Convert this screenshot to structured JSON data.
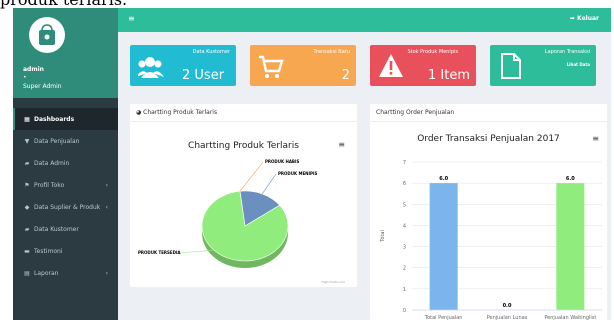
{
  "caption": "produk terlaris.",
  "topbar": {
    "menu_icon": "≡",
    "logout_label": "➦ Keluar"
  },
  "user": {
    "name": "admin",
    "status_dot": "•",
    "role": "Super Admin"
  },
  "sidebar": {
    "items": [
      {
        "label": "Dashboards",
        "icon": "dashboard-icon",
        "glyph": "▦",
        "active": true,
        "chevron": ""
      },
      {
        "label": "Data Penjualan",
        "icon": "cart-icon",
        "glyph": "▼",
        "active": false,
        "chevron": ""
      },
      {
        "label": "Data Admin",
        "icon": "users-icon",
        "glyph": "▰",
        "active": false,
        "chevron": ""
      },
      {
        "label": "Profil Toko",
        "icon": "store-icon",
        "glyph": "⚑",
        "active": false,
        "chevron": "‹"
      },
      {
        "label": "Data Suplier & Produk",
        "icon": "tag-icon",
        "glyph": "◆",
        "active": false,
        "chevron": "‹"
      },
      {
        "label": "Data Kustomer",
        "icon": "customers-icon",
        "glyph": "▰",
        "active": false,
        "chevron": ""
      },
      {
        "label": "Testimoni",
        "icon": "comments-icon",
        "glyph": "▬",
        "active": false,
        "chevron": ""
      },
      {
        "label": "Laporan",
        "icon": "report-icon",
        "glyph": "▤",
        "active": false,
        "chevron": "‹"
      }
    ]
  },
  "stats": [
    {
      "label": "Data Kustomer",
      "value": "2 User",
      "color": "#22bcd2",
      "icon": "users-icon"
    },
    {
      "label": "Transaksi Baru",
      "value": "2",
      "color": "#f6a750",
      "icon": "shopping-cart-icon"
    },
    {
      "label": "Stok Produk Menipis",
      "value": "1 Item",
      "color": "#e8505b",
      "icon": "warning-icon"
    },
    {
      "label": "Laporan Transaksi",
      "value": "",
      "sub": "Lihat Data",
      "color": "#2dbd9a",
      "icon": "document-icon"
    }
  ],
  "panels": {
    "pie": {
      "header": "◕ Chartting Produk Terlaris",
      "menu_icon": "≡",
      "credit": "Highcharts.com"
    },
    "bar": {
      "header": "Chartting Order Penjualan",
      "menu_icon": "≡",
      "credit": "Highcharts.com"
    }
  },
  "chart_data": [
    {
      "type": "pie",
      "title": "Chartting Produk Terlaris",
      "slices": [
        {
          "name": "PRODUK HABIS",
          "value": 0.1,
          "color": "#f7a35c"
        },
        {
          "name": "PRODUK MENIPIS",
          "value": 16.7,
          "color": "#6b8fbf"
        },
        {
          "name": "PRODUK TERSEDIA",
          "value": 83.2,
          "color": "#90ed7d"
        }
      ]
    },
    {
      "type": "bar",
      "title": "Order Transaksi Penjualan 2017",
      "ylabel": "Total",
      "categories": [
        "Total Penjualan",
        "Penjualan Lunas",
        "Penjualan Waitinglist"
      ],
      "values": [
        6,
        0,
        6
      ],
      "data_labels": [
        "6.0",
        "0.0",
        "6.0"
      ],
      "colors": [
        "#7cb5ec",
        "#434348",
        "#90ed7d"
      ],
      "ylim": [
        0,
        7
      ],
      "yticks": [
        0,
        1,
        2,
        3,
        4,
        5,
        6,
        7
      ]
    }
  ]
}
